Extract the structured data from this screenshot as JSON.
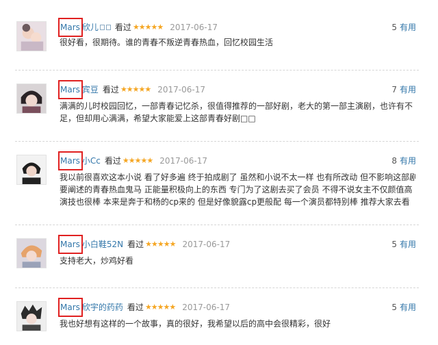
{
  "useful_label": "有用",
  "reviews": [
    {
      "handle": "Mars",
      "username": "欣儿",
      "username_marks": 2,
      "status": "看过",
      "stars": "★★★★★",
      "date": "2017-06-17",
      "useful_count": "5",
      "lines": [
        "很好看，很期待。谁的青春不叛逆青春热血，回忆校园生活"
      ]
    },
    {
      "handle": "Mars",
      "username": "宾豆",
      "username_marks": 0,
      "status": "看过",
      "stars": "★★★★★",
      "date": "2017-06-17",
      "useful_count": "7",
      "lines": [
        "满满的儿时校园回忆，一部青春记忆杀，很值得推荐的一部好剧，老大的第一部主演剧，也许有不",
        "足，但却用心满满，希望大家能爱上这部青春好剧□□"
      ]
    },
    {
      "handle": "Mars",
      "username": "小Cc",
      "username_marks": 0,
      "status": "看过",
      "stars": "★★★★★",
      "date": "2017-06-17",
      "useful_count": "8",
      "lines": [
        "我以前很喜欢这本小说 看了好多遍 终于拍成剧了 虽然和小说不太一样 也有所改动 但不影响这部剧",
        "要阐述的青春热血鬼马 正能量积极向上的东西 专门为了这剧去买了会员 不得不说女主不仅颜值高",
        "演技也很棒 本来是奔于和杨的cp来的 但是好像貌露cp更般配 每一个演员都特别棒 推荐大家去看"
      ]
    },
    {
      "handle": "Mars",
      "username": "小白鞋52N",
      "username_marks": 0,
      "status": "看过",
      "stars": "★★★★★",
      "date": "2017-06-17",
      "useful_count": "5",
      "lines": [
        "支持老大，炒鸡好看"
      ]
    },
    {
      "handle": "Mars",
      "username": "欣宇的药药",
      "username_marks": 0,
      "status": "看过",
      "stars": "★★★★★",
      "date": "2017-06-17",
      "useful_count": "5",
      "lines": [
        "我也好想有这样的一个故事，真的很好，我希望以后的高中会很精彩，很好"
      ]
    }
  ]
}
